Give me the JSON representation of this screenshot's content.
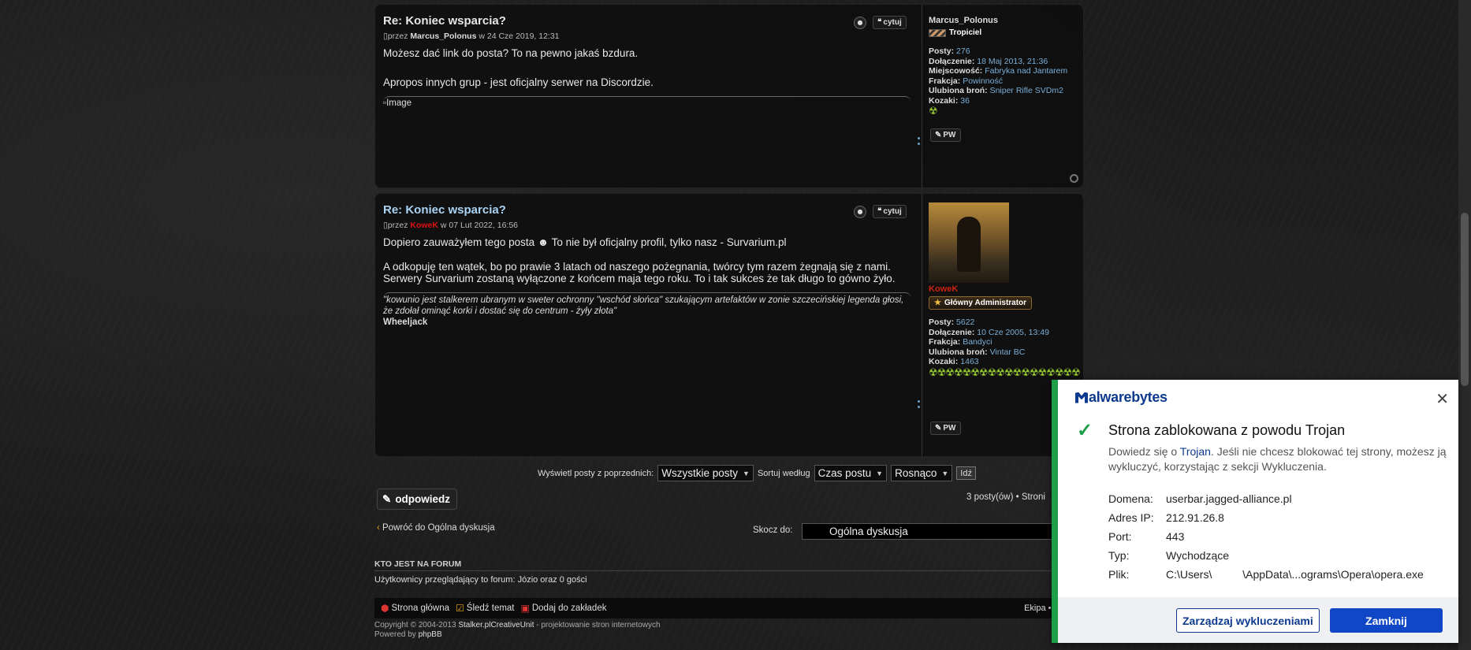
{
  "post1": {
    "title": "Re: Koniec wsparcia?",
    "author_prefix": "przez",
    "author": "Marcus_Polonus",
    "date_prefix": "w",
    "date": "24 Cze 2019, 12:31",
    "paragraphs": [
      "Możesz dać link do posta? To na pewno jakaś bzdura.",
      "Apropos innych grup - jest oficjalny serwer na Discordzie."
    ],
    "image_alt": "Image",
    "quote_label": "cytuj",
    "profile": {
      "username": "Marcus_Polonus",
      "rank": "Tropiciel",
      "posts_label": "Posty:",
      "posts": "276",
      "joined_label": "Dołączenie:",
      "joined": "18 Maj 2013, 21:36",
      "location_label": "Miejscowość:",
      "location": "Fabryka nad Jantarem",
      "faction_label": "Frakcja:",
      "faction": "Powinność",
      "weapon_label": "Ulubiona broń:",
      "weapon": "Sniper Rifle SVDm2",
      "kozaki_label": "Kozaki:",
      "kozaki": "36",
      "pw_label": "PW"
    }
  },
  "post2": {
    "title": "Re: Koniec wsparcia?",
    "author_prefix": "przez",
    "author": "KoweK",
    "date_prefix": "w",
    "date": "07 Lut 2022, 16:56",
    "line1_a": "Dopiero zauważyłem tego posta",
    "line1_b": "To nie był oficjalny profil, tylko nasz - Survarium.pl",
    "paragraph2": "A odkopuję ten wątek, bo po prawie 3 latach od naszego pożegnania, twórcy tym razem żegnają się z nami. Serwery Survarium zostaną wyłączone z końcem maja tego roku. To i tak sukces że tak długo to gówno żyło.",
    "signature_quote": "\"kowunio jest stalkerem ubranym w sweter ochronny \"wschód słońca\" szukającym artefaktów w zonie szczecińskiej legenda głosi, że zdołał ominąć korki i dostać się do centrum - żyły złota\"",
    "signature_author": "Wheeljack",
    "quote_label": "cytuj",
    "profile": {
      "username": "KoweK",
      "rank": "Główny Administrator",
      "posts_label": "Posty:",
      "posts": "5622",
      "joined_label": "Dołączenie:",
      "joined": "10 Cze 2005, 13:49",
      "faction_label": "Frakcja:",
      "faction": "Bandyci",
      "weapon_label": "Ulubiona broń:",
      "weapon": "Vintar BC",
      "kozaki_label": "Kozaki:",
      "kozaki": "1463",
      "pw_label": "PW"
    }
  },
  "sortbar": {
    "show_label": "Wyświetl posty z poprzednich:",
    "show_value": "Wszystkie posty",
    "sort_label": "Sortuj według",
    "sort_value": "Czas postu",
    "order_value": "Rosnąco",
    "go_label": "Idź"
  },
  "actions": {
    "reply_label": "odpowiedz",
    "post_count": "3 posty(ów) • Stroni",
    "back_label": "Powróć do Ogólna dyskusja",
    "jump_label": "Skocz do:",
    "jump_value": "Ogólna dyskusja"
  },
  "who": {
    "title": "KTO JEST NA FORUM",
    "text": "Użytkownicy przeglądający to forum: Józio oraz 0 gości"
  },
  "footer": {
    "home": "Strona główna",
    "follow": "Śledź temat",
    "bookmark": "Dodaj do zakładek",
    "team": "Ekipa • Ko",
    "copyright_prefix": "Copyright © 2004-2013",
    "copyright_site": "Stalker.plCreativeUnit",
    "copyright_suffix": "- projektowanie stron internetowych",
    "powered_prefix": "Powered by",
    "powered_by": "phpBB"
  },
  "malwarebytes": {
    "brand": "alwarebytes",
    "title": "Strona zablokowana z powodu Trojan",
    "desc_prefix": "Dowiedz się o",
    "desc_link": "Trojan",
    "desc_suffix": ". Jeśli nie chcesz blokować tej strony, możesz ją wykluczyć, korzystając z sekcji Wykluczenia.",
    "details": [
      {
        "key": "Domena:",
        "value": "userbar.jagged-alliance.pl"
      },
      {
        "key": "Adres IP:",
        "value": "212.91.26.8"
      },
      {
        "key": "Port:",
        "value": "443"
      },
      {
        "key": "Typ:",
        "value": "Wychodzące"
      },
      {
        "key": "Plik:",
        "value": "C:\\Users\\          \\AppData\\...ograms\\Opera\\opera.exe"
      }
    ],
    "manage_label": "Zarządzaj wykluczeniami",
    "dismiss_label": "Zamknij",
    "accent": "#1f9e4a",
    "brand_color": "#0d3a8f"
  }
}
